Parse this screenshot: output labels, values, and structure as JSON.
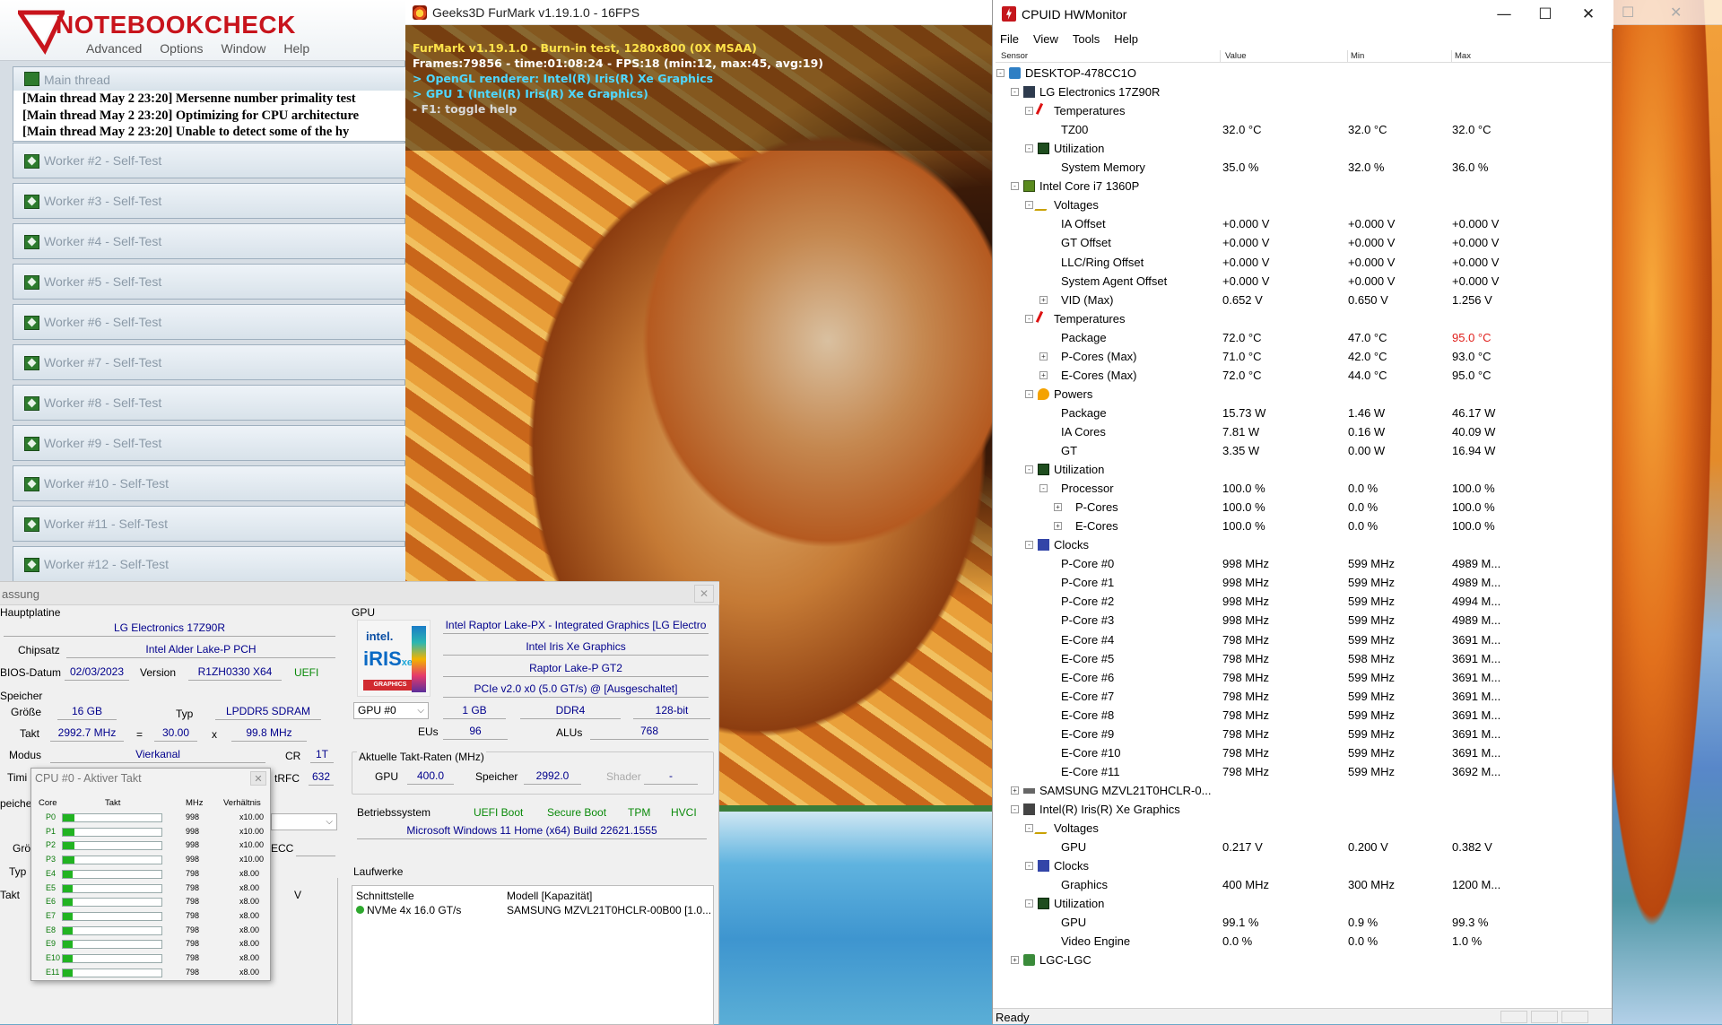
{
  "prime95": {
    "logo_text": "NOTEBOOKCHECK",
    "menu": [
      "Advanced",
      "Options",
      "Window",
      "Help"
    ],
    "main_thread": {
      "label": "Main thread",
      "lines": [
        "[Main thread May 2 23:20] Mersenne number primality test",
        "[Main thread May 2 23:20] Optimizing for CPU architecture",
        "[Main thread May 2 23:20] Unable to detect some of the hy"
      ]
    },
    "workers": [
      "Worker #2 - Self-Test",
      "Worker #3 - Self-Test",
      "Worker #4 - Self-Test",
      "Worker #5 - Self-Test",
      "Worker #6 - Self-Test",
      "Worker #7 - Self-Test",
      "Worker #8 - Self-Test",
      "Worker #9 - Self-Test",
      "Worker #10 - Self-Test",
      "Worker #11 - Self-Test",
      "Worker #12 - Self-Test"
    ]
  },
  "furmark": {
    "title": "Geeks3D FurMark v1.19.1.0 - 16FPS",
    "overlay": [
      "FurMark v1.19.1.0 - Burn-in test, 1280x800 (0X MSAA)",
      "Frames:79856 - time:01:08:24 - FPS:18 (min:12, max:45, avg:19)",
      "> OpenGL renderer: Intel(R) Iris(R) Xe Graphics",
      "> GPU 1 (Intel(R) Iris(R) Xe Graphics)",
      "- F1: toggle help"
    ]
  },
  "summary": {
    "title_fragment": "assung",
    "mainboard": {
      "section": "Hauptplatine",
      "name": "LG Electronics 17Z90R",
      "chipset_label": "Chipsatz",
      "chipset": "Intel Alder Lake-P PCH",
      "bios_date_label": "BIOS-Datum",
      "bios_date": "02/03/2023",
      "version_label": "Version",
      "version": "R1ZH0330 X64",
      "uefi": "UEFI"
    },
    "memory": {
      "section": "Speicher",
      "size_label": "Größe",
      "size": "16 GB",
      "type_label": "Typ",
      "type": "LPDDR5 SDRAM",
      "clock_label": "Takt",
      "clock": "2992.7 MHz",
      "eq": "=",
      "multiplier": "30.00",
      "x": "x",
      "bclk": "99.8 MHz",
      "mode_label": "Modus",
      "mode": "Vierkanal",
      "cr_label": "CR",
      "cr": "1T",
      "timing_label": "Timi",
      "trfc_label": "tRFC",
      "trfc": "632",
      "speicher2_label": "peiche",
      "gro2_label": "Grö",
      "ecc_label": "ECC",
      "typ2_label": "Typ",
      "takt2_label": "Takt",
      "v_label": "V"
    },
    "gpu": {
      "section": "GPU",
      "intel_word": "intel.",
      "iris_word": "iRIS",
      "xe_word": "xe",
      "graphics_word": "GRAPHICS",
      "name_full": "Intel Raptor Lake-PX - Integrated Graphics [LG Electro",
      "name": "Intel Iris Xe Graphics",
      "codename": "Raptor Lake-P GT2",
      "pcie": "PCIe v2.0 x0 (5.0 GT/s) @ [Ausgeschaltet]",
      "selector": "GPU #0",
      "vram": "1 GB",
      "vram_type": "DDR4",
      "bus": "128-bit",
      "eus_label": "EUs",
      "eus": "96",
      "alus_label": "ALUs",
      "alus": "768",
      "clocks_label": "Aktuelle Takt-Raten (MHz)",
      "gpu_clock_label": "GPU",
      "gpu_clock": "400.0",
      "mem_clock_label": "Speicher",
      "mem_clock": "2992.0",
      "shader_label": "Shader",
      "shader": "-"
    },
    "os": {
      "label": "Betriebssystem",
      "flags": [
        "UEFI Boot",
        "Secure Boot",
        "TPM",
        "HVCI"
      ],
      "name": "Microsoft Windows 11 Home (x64) Build 22621.1555"
    },
    "drives": {
      "section": "Laufwerke",
      "col_interface": "Schnittstelle",
      "col_model": "Modell [Kapazität]",
      "interface": "NVMe 4x 16.0 GT/s",
      "model": "SAMSUNG MZVL21T0HCLR-00B00 [1.0..."
    }
  },
  "cpu_popup": {
    "title": "CPU #0 - Aktiver Takt",
    "headers": {
      "core": "Core",
      "clock": "Takt",
      "mhz": "MHz",
      "ratio": "Verhältnis"
    },
    "cores": [
      {
        "name": "P0",
        "mhz": "998",
        "ratio": "x10.00",
        "fill": 0.12
      },
      {
        "name": "P1",
        "mhz": "998",
        "ratio": "x10.00",
        "fill": 0.12
      },
      {
        "name": "P2",
        "mhz": "998",
        "ratio": "x10.00",
        "fill": 0.12
      },
      {
        "name": "P3",
        "mhz": "998",
        "ratio": "x10.00",
        "fill": 0.12
      },
      {
        "name": "E4",
        "mhz": "798",
        "ratio": "x8.00",
        "fill": 0.1
      },
      {
        "name": "E5",
        "mhz": "798",
        "ratio": "x8.00",
        "fill": 0.1
      },
      {
        "name": "E6",
        "mhz": "798",
        "ratio": "x8.00",
        "fill": 0.1
      },
      {
        "name": "E7",
        "mhz": "798",
        "ratio": "x8.00",
        "fill": 0.1
      },
      {
        "name": "E8",
        "mhz": "798",
        "ratio": "x8.00",
        "fill": 0.1
      },
      {
        "name": "E9",
        "mhz": "798",
        "ratio": "x8.00",
        "fill": 0.1
      },
      {
        "name": "E10",
        "mhz": "798",
        "ratio": "x8.00",
        "fill": 0.1
      },
      {
        "name": "E11",
        "mhz": "798",
        "ratio": "x8.00",
        "fill": 0.1
      }
    ]
  },
  "hwmonitor": {
    "title": "CPUID HWMonitor",
    "window_buttons": {
      "minimize": "—",
      "maximize": "☐",
      "close": "✕"
    },
    "menu": [
      "File",
      "View",
      "Tools",
      "Help"
    ],
    "columns": {
      "sensor": "Sensor",
      "value": "Value",
      "min": "Min",
      "max": "Max"
    },
    "rows": [
      {
        "level": 0,
        "icon": "computer-icon",
        "name": "DESKTOP-478CC1O",
        "value": "",
        "min": "",
        "max": "",
        "exp": "-"
      },
      {
        "level": 1,
        "icon": "motherboard-icon",
        "name": "LG Electronics 17Z90R",
        "value": "",
        "min": "",
        "max": "",
        "exp": "-"
      },
      {
        "level": 2,
        "icon": "temperature-icon",
        "name": "Temperatures",
        "value": "",
        "min": "",
        "max": "",
        "exp": "-"
      },
      {
        "level": 3,
        "icon": "",
        "name": "TZ00",
        "value": "32.0 °C",
        "min": "32.0 °C",
        "max": "32.0 °C",
        "exp": ""
      },
      {
        "level": 2,
        "icon": "utilization-icon",
        "name": "Utilization",
        "value": "",
        "min": "",
        "max": "",
        "exp": "-"
      },
      {
        "level": 3,
        "icon": "",
        "name": "System Memory",
        "value": "35.0 %",
        "min": "32.0 %",
        "max": "36.0 %",
        "exp": ""
      },
      {
        "level": 1,
        "icon": "cpu-icon",
        "name": "Intel Core i7 1360P",
        "value": "",
        "min": "",
        "max": "",
        "exp": "-"
      },
      {
        "level": 2,
        "icon": "voltage-icon",
        "name": "Voltages",
        "value": "",
        "min": "",
        "max": "",
        "exp": "-"
      },
      {
        "level": 3,
        "icon": "",
        "name": "IA Offset",
        "value": "+0.000 V",
        "min": "+0.000 V",
        "max": "+0.000 V",
        "exp": ""
      },
      {
        "level": 3,
        "icon": "",
        "name": "GT Offset",
        "value": "+0.000 V",
        "min": "+0.000 V",
        "max": "+0.000 V",
        "exp": ""
      },
      {
        "level": 3,
        "icon": "",
        "name": "LLC/Ring Offset",
        "value": "+0.000 V",
        "min": "+0.000 V",
        "max": "+0.000 V",
        "exp": ""
      },
      {
        "level": 3,
        "icon": "",
        "name": "System Agent Offset",
        "value": "+0.000 V",
        "min": "+0.000 V",
        "max": "+0.000 V",
        "exp": ""
      },
      {
        "level": 3,
        "icon": "",
        "name": "VID (Max)",
        "value": "0.652 V",
        "min": "0.650 V",
        "max": "1.256 V",
        "exp": "+"
      },
      {
        "level": 2,
        "icon": "temperature-icon",
        "name": "Temperatures",
        "value": "",
        "min": "",
        "max": "",
        "exp": "-"
      },
      {
        "level": 3,
        "icon": "",
        "name": "Package",
        "value": "72.0 °C",
        "min": "47.0 °C",
        "max": "95.0 °C",
        "exp": "",
        "hot": true
      },
      {
        "level": 3,
        "icon": "",
        "name": "P-Cores (Max)",
        "value": "71.0 °C",
        "min": "42.0 °C",
        "max": "93.0 °C",
        "exp": "+"
      },
      {
        "level": 3,
        "icon": "",
        "name": "E-Cores (Max)",
        "value": "72.0 °C",
        "min": "44.0 °C",
        "max": "95.0 °C",
        "exp": "+"
      },
      {
        "level": 2,
        "icon": "power-icon",
        "name": "Powers",
        "value": "",
        "min": "",
        "max": "",
        "exp": "-"
      },
      {
        "level": 3,
        "icon": "",
        "name": "Package",
        "value": "15.73 W",
        "min": "1.46 W",
        "max": "46.17 W",
        "exp": ""
      },
      {
        "level": 3,
        "icon": "",
        "name": "IA Cores",
        "value": "7.81 W",
        "min": "0.16 W",
        "max": "40.09 W",
        "exp": ""
      },
      {
        "level": 3,
        "icon": "",
        "name": "GT",
        "value": "3.35 W",
        "min": "0.00 W",
        "max": "16.94 W",
        "exp": ""
      },
      {
        "level": 2,
        "icon": "utilization-icon",
        "name": "Utilization",
        "value": "",
        "min": "",
        "max": "",
        "exp": "-"
      },
      {
        "level": 3,
        "icon": "",
        "name": "Processor",
        "value": "100.0 %",
        "min": "0.0 %",
        "max": "100.0 %",
        "exp": "-"
      },
      {
        "level": 4,
        "icon": "",
        "name": "P-Cores",
        "value": "100.0 %",
        "min": "0.0 %",
        "max": "100.0 %",
        "exp": "+"
      },
      {
        "level": 4,
        "icon": "",
        "name": "E-Cores",
        "value": "100.0 %",
        "min": "0.0 %",
        "max": "100.0 %",
        "exp": "+"
      },
      {
        "level": 2,
        "icon": "clock-icon",
        "name": "Clocks",
        "value": "",
        "min": "",
        "max": "",
        "exp": "-"
      },
      {
        "level": 3,
        "icon": "",
        "name": "P-Core #0",
        "value": "998 MHz",
        "min": "599 MHz",
        "max": "4989 M...",
        "exp": ""
      },
      {
        "level": 3,
        "icon": "",
        "name": "P-Core #1",
        "value": "998 MHz",
        "min": "599 MHz",
        "max": "4989 M...",
        "exp": ""
      },
      {
        "level": 3,
        "icon": "",
        "name": "P-Core #2",
        "value": "998 MHz",
        "min": "599 MHz",
        "max": "4994 M...",
        "exp": ""
      },
      {
        "level": 3,
        "icon": "",
        "name": "P-Core #3",
        "value": "998 MHz",
        "min": "599 MHz",
        "max": "4989 M...",
        "exp": ""
      },
      {
        "level": 3,
        "icon": "",
        "name": "E-Core #4",
        "value": "798 MHz",
        "min": "599 MHz",
        "max": "3691 M...",
        "exp": ""
      },
      {
        "level": 3,
        "icon": "",
        "name": "E-Core #5",
        "value": "798 MHz",
        "min": "598 MHz",
        "max": "3691 M...",
        "exp": ""
      },
      {
        "level": 3,
        "icon": "",
        "name": "E-Core #6",
        "value": "798 MHz",
        "min": "599 MHz",
        "max": "3691 M...",
        "exp": ""
      },
      {
        "level": 3,
        "icon": "",
        "name": "E-Core #7",
        "value": "798 MHz",
        "min": "599 MHz",
        "max": "3691 M...",
        "exp": ""
      },
      {
        "level": 3,
        "icon": "",
        "name": "E-Core #8",
        "value": "798 MHz",
        "min": "599 MHz",
        "max": "3691 M...",
        "exp": ""
      },
      {
        "level": 3,
        "icon": "",
        "name": "E-Core #9",
        "value": "798 MHz",
        "min": "599 MHz",
        "max": "3691 M...",
        "exp": ""
      },
      {
        "level": 3,
        "icon": "",
        "name": "E-Core #10",
        "value": "798 MHz",
        "min": "599 MHz",
        "max": "3691 M...",
        "exp": ""
      },
      {
        "level": 3,
        "icon": "",
        "name": "E-Core #11",
        "value": "798 MHz",
        "min": "599 MHz",
        "max": "3692 M...",
        "exp": ""
      },
      {
        "level": 1,
        "icon": "drive-icon",
        "name": "SAMSUNG MZVL21T0HCLR-0...",
        "value": "",
        "min": "",
        "max": "",
        "exp": "+"
      },
      {
        "level": 1,
        "icon": "gpu-icon",
        "name": "Intel(R) Iris(R) Xe Graphics",
        "value": "",
        "min": "",
        "max": "",
        "exp": "-"
      },
      {
        "level": 2,
        "icon": "voltage-icon",
        "name": "Voltages",
        "value": "",
        "min": "",
        "max": "",
        "exp": "-"
      },
      {
        "level": 3,
        "icon": "",
        "name": "GPU",
        "value": "0.217 V",
        "min": "0.200 V",
        "max": "0.382 V",
        "exp": ""
      },
      {
        "level": 2,
        "icon": "clock-icon",
        "name": "Clocks",
        "value": "",
        "min": "",
        "max": "",
        "exp": "-"
      },
      {
        "level": 3,
        "icon": "",
        "name": "Graphics",
        "value": "400 MHz",
        "min": "300 MHz",
        "max": "1200 M...",
        "exp": ""
      },
      {
        "level": 2,
        "icon": "utilization-icon",
        "name": "Utilization",
        "value": "",
        "min": "",
        "max": "",
        "exp": "-"
      },
      {
        "level": 3,
        "icon": "",
        "name": "GPU",
        "value": "99.1 %",
        "min": "0.9 %",
        "max": "99.3 %",
        "exp": ""
      },
      {
        "level": 3,
        "icon": "",
        "name": "Video Engine",
        "value": "0.0 %",
        "min": "0.0 %",
        "max": "1.0 %",
        "exp": ""
      },
      {
        "level": 1,
        "icon": "chip-icon",
        "name": "LGC-LGC",
        "value": "",
        "min": "",
        "max": "",
        "exp": "+"
      }
    ],
    "status": "Ready"
  },
  "desktop": {
    "ghost_window_buttons": {
      "maximize": "☐",
      "close": "✕"
    }
  }
}
